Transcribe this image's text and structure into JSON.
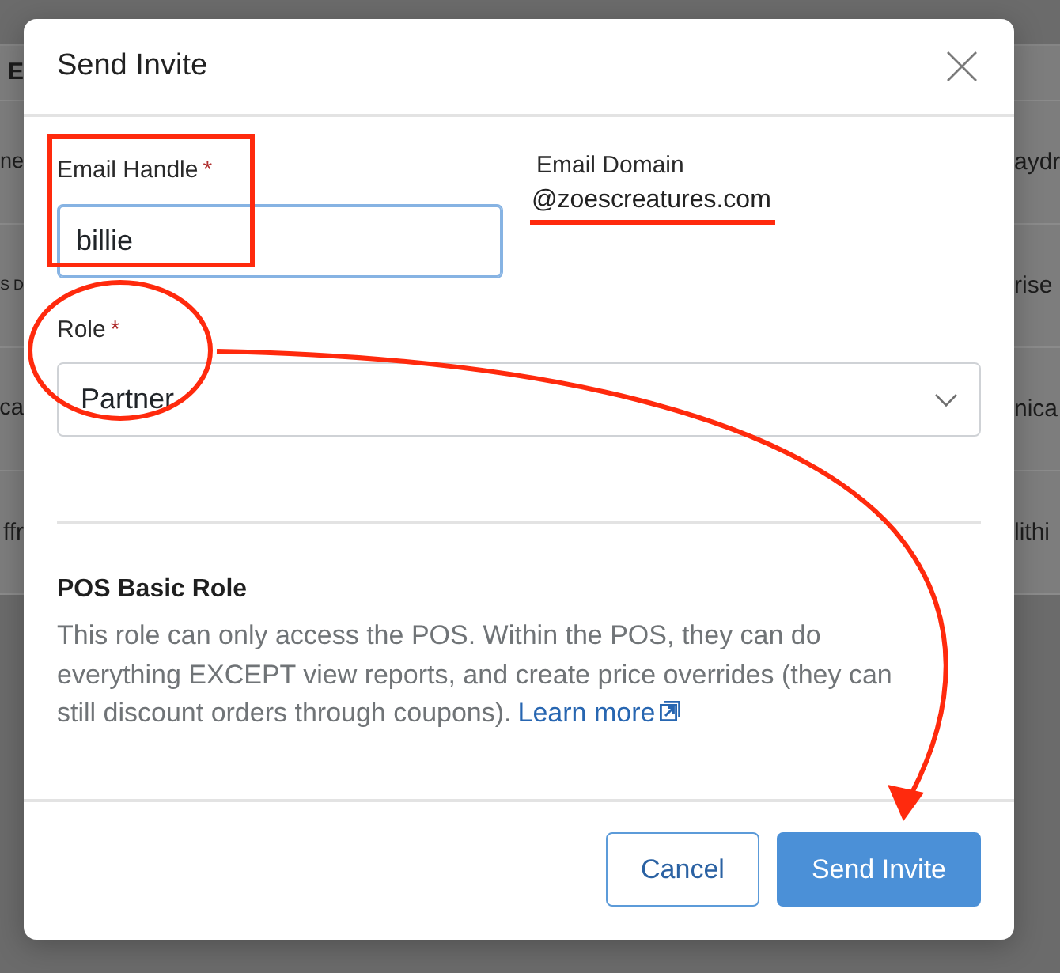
{
  "background_table": {
    "header": "E",
    "rows": [
      [
        "ne",
        "aydr"
      ],
      [
        "S D",
        "rise"
      ],
      [
        "ca",
        "nica"
      ],
      [
        "ffr",
        "lithi"
      ]
    ]
  },
  "dialog": {
    "title": "Send Invite",
    "email_handle": {
      "label": "Email Handle",
      "required_mark": "*",
      "value": "billie",
      "focused": true
    },
    "email_domain": {
      "label": "Email Domain",
      "value": "@zoescreatures.com"
    },
    "role": {
      "label": "Role",
      "required_mark": "*",
      "value": "Partner"
    },
    "role_info": {
      "title": "POS Basic Role",
      "description": "This role can only access the POS. Within the POS, they can do everything EXCEPT view reports, and create price overrides (they can still discount orders through coupons).",
      "link": "Learn more"
    },
    "buttons": [
      {
        "label": "Cancel",
        "kind": "outline"
      },
      {
        "label": "Send Invite",
        "kind": "primary"
      }
    ]
  },
  "annotations": [
    {
      "kind": "rectangle"
    },
    {
      "kind": "underline"
    },
    {
      "kind": "ellipse"
    },
    {
      "kind": "arrow"
    }
  ]
}
